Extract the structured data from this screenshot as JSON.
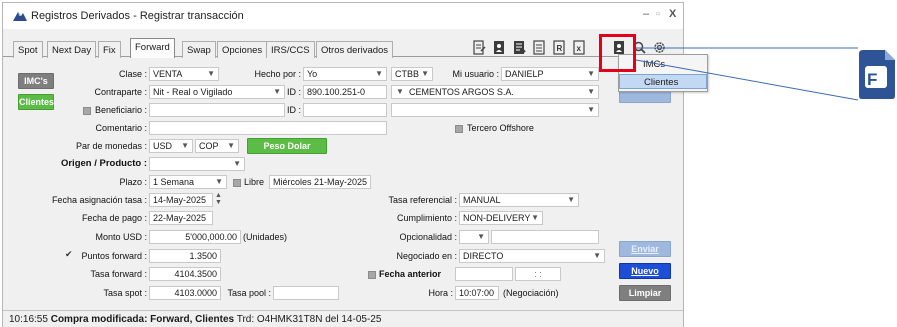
{
  "window": {
    "title": "Registros Derivados - Registrar transacción",
    "controls": [
      "–",
      "▫",
      "X"
    ]
  },
  "tabs": [
    {
      "label": "Spot",
      "underline": "S",
      "active": false
    },
    {
      "label": "Next Day",
      "underline": "x",
      "active": false
    },
    {
      "label": "Fix",
      "underline": "",
      "active": false
    },
    {
      "label": "Forward",
      "underline": "F",
      "active": true
    },
    {
      "label": "Swap",
      "underline": "w",
      "active": false
    },
    {
      "label": "Opciones",
      "underline": "p",
      "active": false
    },
    {
      "label": "IRS/CCS",
      "underline": "R",
      "active": false
    },
    {
      "label": "Otros derivados",
      "underline": "r",
      "active": false
    }
  ],
  "toolbar_icons": [
    "edit-document-icon",
    "client-document-icon",
    "list-document-icon",
    "sheet-document-icon",
    "r-document-icon",
    "x-document-icon",
    "client-file-icon",
    "search-icon",
    "settings-icon"
  ],
  "side_buttons": {
    "imcs": "IMC's",
    "clientes": "Clientes"
  },
  "form": {
    "clase": {
      "label": "Clase :",
      "value": "VENTA"
    },
    "hecho_por": {
      "label": "Hecho por :",
      "value": "Yo"
    },
    "ctbb": {
      "value": "CTBB"
    },
    "mi_usuario": {
      "label": "Mi usuario :",
      "value": "DANIELP"
    },
    "contraparte": {
      "label": "Contraparte :",
      "value": "Nit - Real o Vigilado"
    },
    "id1": {
      "label": "ID :",
      "value": "890.100.251-0"
    },
    "empresa": {
      "value": "CEMENTOS ARGOS S.A."
    },
    "beneficiario": {
      "label": "Beneficiario :"
    },
    "id2": {
      "label": "ID :"
    },
    "comentario": {
      "label": "Comentario :"
    },
    "tercero": {
      "label": "Tercero Offshore"
    },
    "par_monedas": {
      "label": "Par de monedas :",
      "value1": "USD",
      "value2": "COP",
      "button": "Peso Dolar"
    },
    "origen": {
      "label": "Origen / Producto :"
    },
    "plazo": {
      "label": "Plazo :",
      "value": "1 Semana",
      "libre": "Libre",
      "fecha_libre": "Miércoles 21-May-2025"
    },
    "fecha_asignacion": {
      "label": "Fecha asignación tasa :",
      "value": "14-May-2025"
    },
    "tasa_referencial": {
      "label": "Tasa referencial :",
      "value": "MANUAL"
    },
    "fecha_pago": {
      "label": "Fecha de pago :",
      "value": "22-May-2025"
    },
    "cumplimiento": {
      "label": "Cumplimiento :",
      "value": "NON-DELIVERY"
    },
    "monto_usd": {
      "label": "Monto USD :",
      "value": "5'000,000.00",
      "units": "(Unidades)"
    },
    "opcionalidad": {
      "label": "Opcionalidad :"
    },
    "puntos_forward": {
      "label": "Puntos forward :",
      "value": "1.3500"
    },
    "negociado_en": {
      "label": "Negociado en :",
      "value": "DIRECTO"
    },
    "tasa_forward": {
      "label": "Tasa forward :",
      "value": "4104.3500"
    },
    "fecha_anterior": {
      "label": "Fecha anterior",
      "time_placeholder": ": :"
    },
    "tasa_spot": {
      "label": "Tasa spot :",
      "value": "4103.0000"
    },
    "tasa_pool": {
      "label": "Tasa pool :"
    },
    "hora": {
      "label": "Hora :",
      "value": "10:07:00",
      "note": "(Negociación)"
    }
  },
  "action_buttons": {
    "enviar": "Enviar",
    "nuevo": "Nuevo",
    "limpiar": "Limpiar"
  },
  "dropdown_menu": {
    "items": [
      "IMCs",
      "Clientes"
    ],
    "selected": "Clientes"
  },
  "status_bar": {
    "time": "10:16:55",
    "message": "Compra modificada: Forward, Clientes",
    "detail": "Trd: O4HMK31T8N del 14-05-25"
  },
  "colors": {
    "green": "#5bbd45",
    "blue": "#1c4fd6",
    "highlight": "#e3001b",
    "gray_button": "#7f7f7f"
  }
}
